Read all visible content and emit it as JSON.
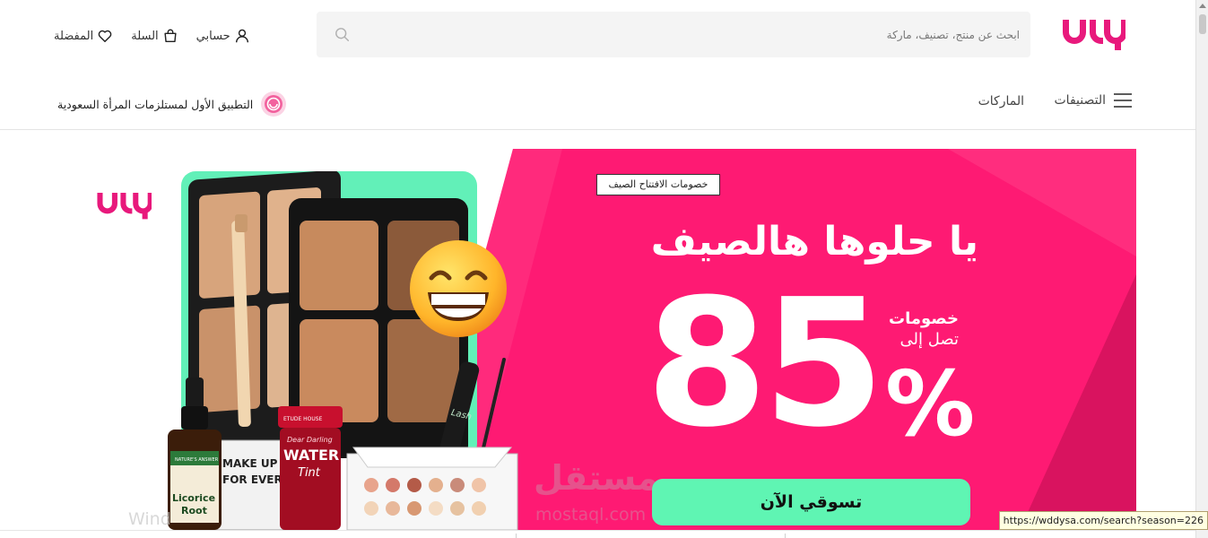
{
  "header": {
    "logo_text": "ودي",
    "search": {
      "placeholder": "ابحث عن منتج، تصنيف، ماركة"
    },
    "actions": {
      "account": "حسابي",
      "cart": "السلة",
      "favorites": "المفضلة"
    },
    "nav": {
      "categories": "التصنيفات",
      "brands": "الماركات"
    },
    "tagline": "التطبيق الأول لمستلزمات المرأة السعودية"
  },
  "banner": {
    "logo_text": "ودي",
    "ribbon": "خصومات الافتتاح الصيف",
    "headline": "يا حلوها هالصيف",
    "discount_line1": "خصومات",
    "discount_line2": "تصل إلى",
    "discount_value": "85",
    "percent_sign": "%",
    "cta": "تسوقي الآن",
    "product_labels": {
      "tint_brand": "ETUDE HOUSE",
      "tint_line1": "Dear Darling",
      "tint_line2": "WATER",
      "tint_line3": "Tint",
      "dropper_brand": "NATURE'S ANSWER",
      "dropper_line1": "Licorice",
      "dropper_line2": "Root",
      "makeup_text1": "MAKE UP",
      "makeup_text2": "FOR EVER",
      "mascara_text": "Lash"
    },
    "watermark_ar": "مستقل",
    "watermark_en": "mostaql.com"
  },
  "overlay": {
    "windows_ghost": "Wind",
    "status_url": "https://wddysa.com/search?season=226"
  },
  "colors": {
    "brand_pink": "#e8197c",
    "banner_pink": "#fe1a73",
    "mint": "#5ff5b3",
    "dark_pink": "#d9135f"
  }
}
